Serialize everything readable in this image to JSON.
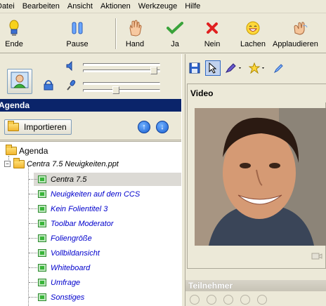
{
  "menu": [
    "Datei",
    "Bearbeiten",
    "Ansicht",
    "Aktionen",
    "Werkzeuge",
    "Hilfe"
  ],
  "toolbar": {
    "buttons": [
      {
        "label": "Ende",
        "icon": "bulb-icon"
      },
      {
        "label": "Pause",
        "icon": "pause-icon"
      },
      {
        "label": "Hand",
        "icon": "hand-icon"
      },
      {
        "label": "Ja",
        "icon": "checkmark-icon"
      },
      {
        "label": "Nein",
        "icon": "cross-icon"
      },
      {
        "label": "Lachen",
        "icon": "laugh-icon"
      },
      {
        "label": "Applaudieren",
        "icon": "applause-icon"
      }
    ]
  },
  "agenda": {
    "header": "Agenda",
    "import_label": "Importieren",
    "root_label": "Agenda",
    "file_label": "Centra 7.5 Neuigkeiten.ppt",
    "slides": [
      "Centra 7.5",
      "Neuigkeiten auf dem CCS",
      "Kein Folientitel 3",
      "Toolbar Moderator",
      "Foliengröße",
      "Vollbildansicht",
      "Whiteboard",
      "Umfrage",
      "Sonstiges"
    ]
  },
  "video": {
    "title": "Video"
  },
  "participants": {
    "header": "Teilnehmer"
  },
  "colors": {
    "title_bar": "#0a246a",
    "slide_link": "#0000cc",
    "background": "#ece9d8"
  }
}
